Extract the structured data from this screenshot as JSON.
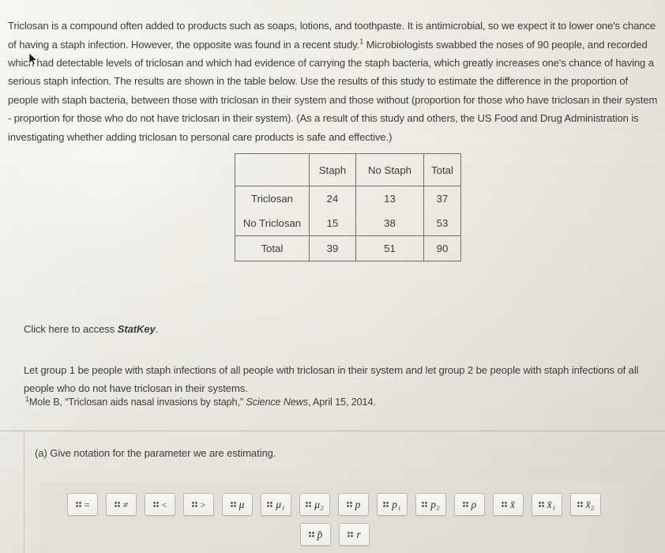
{
  "intro": {
    "text_part1": "Triclosan is a compound often added to products such as soaps, lotions, and toothpaste. It is antimicrobial, so we expect it to lower one's chance of having a staph infection. However, the opposite was found in a recent study.",
    "footnote_marker": "1",
    "text_part2": " Microbiologists swabbed the noses of 90 people, and recorded which had detectable levels of triclosan and which had evidence of carrying the staph bacteria, which greatly increases one's chance of having a serious staph infection. The results are shown in the table below. Use the results of this study to estimate the difference in the proportion of people with staph bacteria, between those with triclosan in their system and those without (proportion for those who have triclosan in their system - proportion for those who do not have triclosan in their system). (As a result of this study and others, the US Food and Drug Administration is investigating whether adding triclosan to personal care products is safe and effective.)"
  },
  "table": {
    "corner": "",
    "columns": [
      "Staph",
      "No Staph",
      "Total"
    ],
    "rows": [
      {
        "label": "Triclosan",
        "values": [
          "24",
          "13",
          "37"
        ]
      },
      {
        "label": "No Triclosan",
        "values": [
          "15",
          "38",
          "53"
        ]
      },
      {
        "label": "Total",
        "values": [
          "39",
          "51",
          "90"
        ]
      }
    ]
  },
  "statkey": {
    "link_text": "Click here",
    "middle_text": " to access ",
    "product_name": "StatKey",
    "end_text": "."
  },
  "groups": {
    "text": "Let group 1 be people with staph infections of all people with triclosan in their system and let group 2 be people with staph infections of all people who do not have triclosan in their systems."
  },
  "footnote": {
    "marker": "1",
    "author": "Mole B, ",
    "title": "“Triclosan aids nasal invasions by staph,” ",
    "source": "Science News",
    "date": ", April 15, 2014."
  },
  "question": {
    "label": "(a) Give notation for the parameter we are estimating."
  },
  "palette": {
    "row1": [
      {
        "name": "equals",
        "glyph": "=",
        "style": "op"
      },
      {
        "name": "not-equal",
        "glyph": "≠",
        "style": "op"
      },
      {
        "name": "less-than",
        "glyph": "<",
        "style": "op"
      },
      {
        "name": "greater-than",
        "glyph": ">",
        "style": "op"
      },
      {
        "name": "mu",
        "glyph": "μ",
        "style": "var"
      },
      {
        "name": "mu-1",
        "glyph": "μ₁",
        "style": "var"
      },
      {
        "name": "mu-2",
        "glyph": "μ₂",
        "style": "var"
      },
      {
        "name": "p",
        "glyph": "p",
        "style": "var"
      },
      {
        "name": "p-1",
        "glyph": "p₁",
        "style": "var"
      },
      {
        "name": "p-2",
        "glyph": "p₂",
        "style": "var"
      },
      {
        "name": "rho",
        "glyph": "ρ",
        "style": "var"
      },
      {
        "name": "x-bar",
        "glyph": "x̄",
        "style": "var"
      },
      {
        "name": "x-bar-1",
        "glyph": "x̄₁",
        "style": "var"
      },
      {
        "name": "x-bar-2",
        "glyph": "x̄₂",
        "style": "var"
      }
    ],
    "row2": [
      {
        "name": "p-hat",
        "glyph": "p̂",
        "style": "var"
      },
      {
        "name": "r",
        "glyph": "r",
        "style": "var"
      }
    ]
  },
  "colors": {
    "page_background": "#ebe9e2",
    "text": "#3b3b39",
    "table_border": "#6f6f6c",
    "button_face": "#f4f3ef",
    "button_border": "#b9b7b0"
  }
}
